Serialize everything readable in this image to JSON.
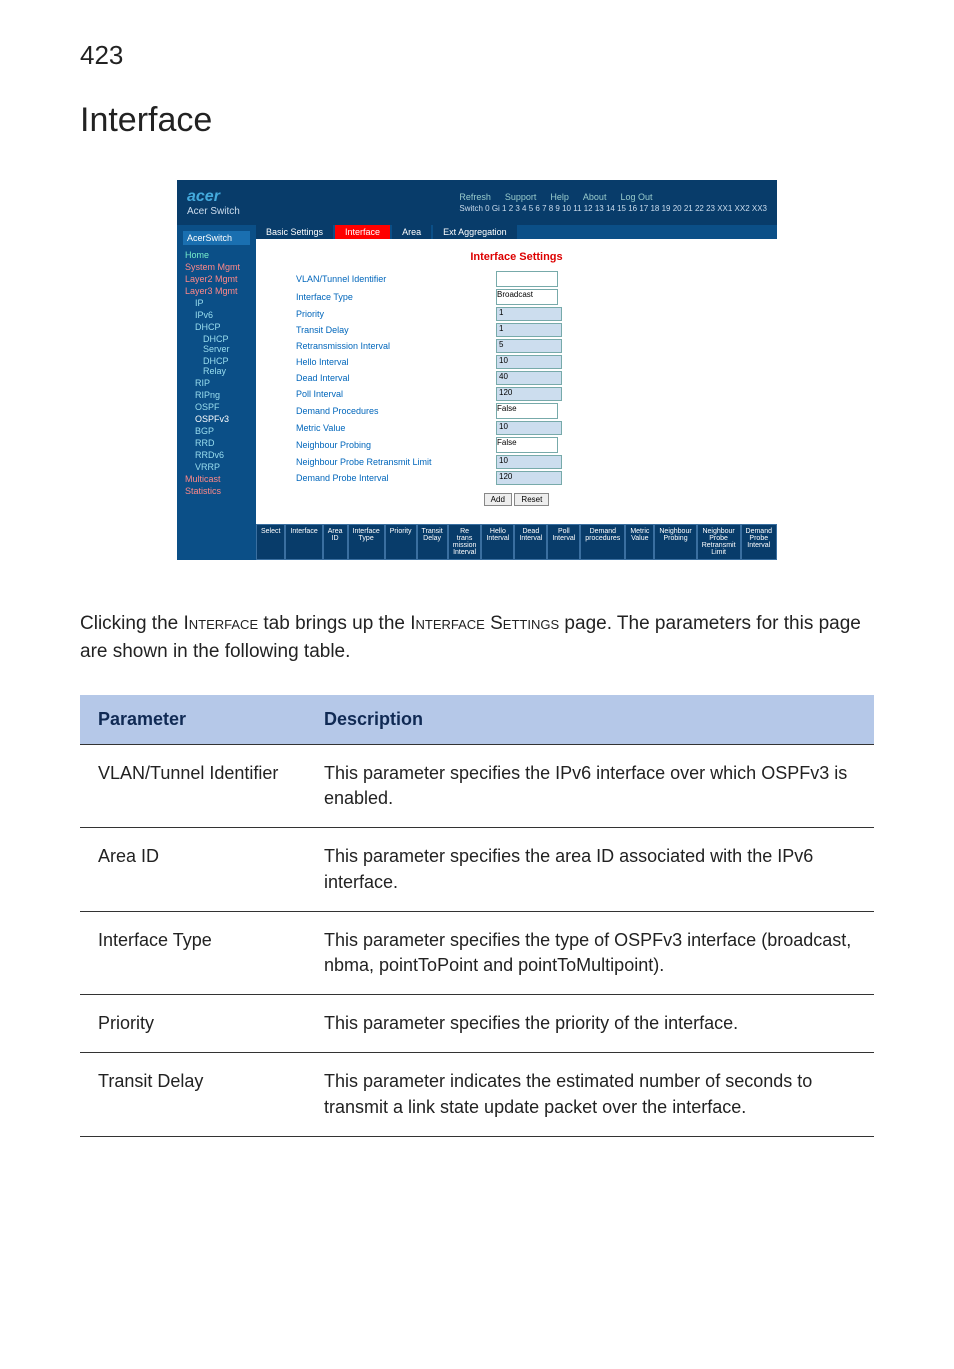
{
  "page_number": "423",
  "title": "Interface",
  "screenshot": {
    "top_links": [
      "Refresh",
      "Support",
      "Help",
      "About",
      "Log Out"
    ],
    "brand": "acer",
    "brand_sub": "Acer Switch",
    "ports_label": "Switch 0 Gi 1 2 3 4 5 6 7 8 9 10 11 12 13 14 15 16 17 18 19 20 21 22 23 XX1 XX2 XX3",
    "nav_header": "AcerSwitch",
    "nav": [
      {
        "label": "Home",
        "cls": ""
      },
      {
        "label": "System Mgmt",
        "cls": "red"
      },
      {
        "label": "Layer2 Mgmt",
        "cls": "red"
      },
      {
        "label": "Layer3 Mgmt",
        "cls": "red"
      },
      {
        "label": "IP",
        "cls": "sub"
      },
      {
        "label": "IPv6",
        "cls": "sub"
      },
      {
        "label": "DHCP",
        "cls": "sub"
      },
      {
        "label": "DHCP Server",
        "cls": "sub2"
      },
      {
        "label": "DHCP Relay",
        "cls": "sub2"
      },
      {
        "label": "RIP",
        "cls": "sub"
      },
      {
        "label": "RIPng",
        "cls": "sub"
      },
      {
        "label": "OSPF",
        "cls": "sub"
      },
      {
        "label": "OSPFv3",
        "cls": "sub sel"
      },
      {
        "label": "BGP",
        "cls": "sub"
      },
      {
        "label": "RRD",
        "cls": "sub"
      },
      {
        "label": "RRDv6",
        "cls": "sub"
      },
      {
        "label": "VRRP",
        "cls": "sub"
      },
      {
        "label": "Multicast",
        "cls": "red"
      },
      {
        "label": "Statistics",
        "cls": "red"
      }
    ],
    "tabs": [
      "Basic Settings",
      "Interface",
      "Area",
      "Ext Aggregation"
    ],
    "settings_title": "Interface Settings",
    "rows": [
      {
        "label": "VLAN/Tunnel Identifier",
        "value": "",
        "type": "select"
      },
      {
        "label": "Interface Type",
        "value": "Broadcast",
        "type": "select"
      },
      {
        "label": "Priority",
        "value": "1",
        "type": "text"
      },
      {
        "label": "Transit Delay",
        "value": "1",
        "type": "text"
      },
      {
        "label": "Retransmission Interval",
        "value": "5",
        "type": "text"
      },
      {
        "label": "Hello Interval",
        "value": "10",
        "type": "text"
      },
      {
        "label": "Dead Interval",
        "value": "40",
        "type": "text"
      },
      {
        "label": "Poll Interval",
        "value": "120",
        "type": "text"
      },
      {
        "label": "Demand Procedures",
        "value": "False",
        "type": "select"
      },
      {
        "label": "Metric Value",
        "value": "10",
        "type": "text"
      },
      {
        "label": "Neighbour Probing",
        "value": "False",
        "type": "select"
      },
      {
        "label": "Neighbour Probe Retransmit Limit",
        "value": "10",
        "type": "text"
      },
      {
        "label": "Demand Probe Interval",
        "value": "120",
        "type": "text"
      }
    ],
    "buttons": [
      "Add",
      "Reset"
    ],
    "grid_cols": [
      "Select",
      "Interface",
      "Area ID",
      "Interface Type",
      "Priority",
      "Transit Delay",
      "Re trans mission Interval",
      "Hello Interval",
      "Dead Interval",
      "Poll Interval",
      "Demand procedures",
      "Metric Value",
      "Neighbour Probing",
      "Neighbour Probe Retransmit Limit",
      "Demand Probe Interval"
    ]
  },
  "intro_parts": {
    "p1": "Clicking the ",
    "sc1": "Interface",
    "p2": " tab brings up the ",
    "sc2": "Interface Settings",
    "p3": " page. The parameters for this page are shown in the following table."
  },
  "table": {
    "head_param": "Parameter",
    "head_desc": "Description",
    "rows": [
      {
        "param": "VLAN/Tunnel Identifier",
        "desc": "This parameter specifies the IPv6 interface over which OSPFv3 is enabled."
      },
      {
        "param": "Area ID",
        "desc": "This parameter specifies the area ID associated with the IPv6 interface."
      },
      {
        "param": "Interface Type",
        "desc": "This parameter specifies the type of OSPFv3 interface (broadcast, nbma, pointToPoint and pointToMultipoint)."
      },
      {
        "param": "Priority",
        "desc": "This parameter specifies the priority of the interface."
      },
      {
        "param": "Transit Delay",
        "desc": "This parameter indicates the estimated number of seconds to transmit a link state update packet over the interface."
      }
    ]
  }
}
